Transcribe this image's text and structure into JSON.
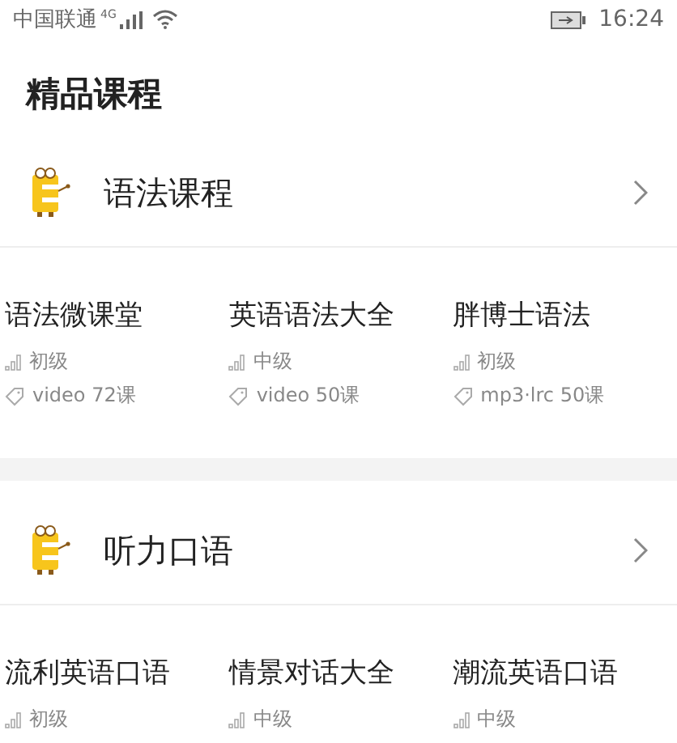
{
  "status_bar": {
    "carrier": "中国联通",
    "network": "4G",
    "time": "16:24"
  },
  "page_title": "精品课程",
  "sections": [
    {
      "title": "语法课程",
      "courses": [
        {
          "title": "语法微课堂",
          "level": "初级",
          "meta": "video 72课"
        },
        {
          "title": "英语语法大全",
          "level": "中级",
          "meta": "video 50课"
        },
        {
          "title": "胖博士语法",
          "level": "初级",
          "meta": "mp3·lrc 50课"
        }
      ]
    },
    {
      "title": "听力口语",
      "courses": [
        {
          "title": "流利英语口语",
          "level": "初级"
        },
        {
          "title": "情景对话大全",
          "level": "中级"
        },
        {
          "title": "潮流英语口语",
          "level": "中级"
        }
      ]
    }
  ]
}
